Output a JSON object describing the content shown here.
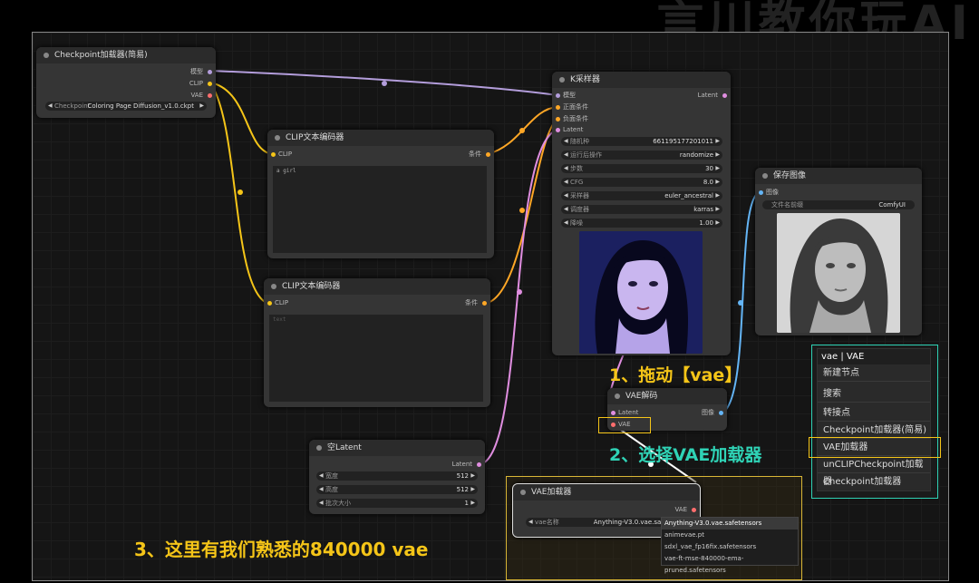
{
  "watermark": "言川教你玩AI",
  "nodes": {
    "checkpoint": {
      "title": "Checkpoint加载器(简易)",
      "outputs": [
        "模型",
        "CLIP",
        "VAE"
      ],
      "widget_label": "Checkpoint",
      "widget_value": "Coloring Page Diffusion_v1.0.ckpt"
    },
    "clip_pos": {
      "title": "CLIP文本编码器",
      "input": "CLIP",
      "output": "条件",
      "text": "a girl"
    },
    "clip_neg": {
      "title": "CLIP文本编码器",
      "input": "CLIP",
      "output": "条件",
      "placeholder": "text"
    },
    "ksampler": {
      "title": "K采样器",
      "inputs": [
        "模型",
        "正面条件",
        "负面条件",
        "Latent"
      ],
      "output": "Latent",
      "widgets": [
        {
          "label": "随机种",
          "value": "661195177201011"
        },
        {
          "label": "运行后操作",
          "value": "randomize"
        },
        {
          "label": "步数",
          "value": "30"
        },
        {
          "label": "CFG",
          "value": "8.0"
        },
        {
          "label": "采样器",
          "value": "euler_ancestral"
        },
        {
          "label": "调度器",
          "value": "karras"
        },
        {
          "label": "降噪",
          "value": "1.00"
        }
      ]
    },
    "save": {
      "title": "保存图像",
      "input": "图像",
      "widget_label": "文件名前缀",
      "widget_value": "ComfyUI"
    },
    "vaedecode": {
      "title": "VAE解码",
      "inputs": [
        "Latent",
        "VAE"
      ],
      "output": "图像"
    },
    "latent": {
      "title": "空Latent",
      "output": "Latent",
      "widgets": [
        {
          "label": "宽度",
          "value": "512"
        },
        {
          "label": "高度",
          "value": "512"
        },
        {
          "label": "批次大小",
          "value": "1"
        }
      ]
    },
    "vaeloader": {
      "title": "VAE加载器",
      "output": "VAE",
      "widget_label": "vae名称",
      "widget_value": "Anything-V3.0.vae.safetensors",
      "dropdown": [
        "Anything-V3.0.vae.safetensors",
        "animevae.pt",
        "sdxl_vae_fp16fix.safetensors",
        "vae-ft-mse-840000-ema-pruned.safetensors"
      ]
    }
  },
  "context_menu": {
    "title": "vae | VAE",
    "items": [
      "新建节点",
      "搜索",
      "转接点",
      "Checkpoint加载器(简易)",
      "VAE加载器",
      "unCLIPCheckpoint加载器",
      "Checkpoint加载器"
    ]
  },
  "annotations": {
    "step1": "1、拖动【vae】",
    "step2": "2、选择VAE加载器",
    "step3": "3、这里有我们熟悉的840000 vae"
  },
  "colors": {
    "accent": "#f5c518",
    "annotation_green": "#2fd3b6",
    "link_model": "#b39ddb",
    "link_clip": "#f5c518",
    "link_latent": "#e08ee0",
    "link_image": "#64b5f6",
    "link_conditioning": "#ffa726",
    "link_vae": "#ff6e6e"
  }
}
